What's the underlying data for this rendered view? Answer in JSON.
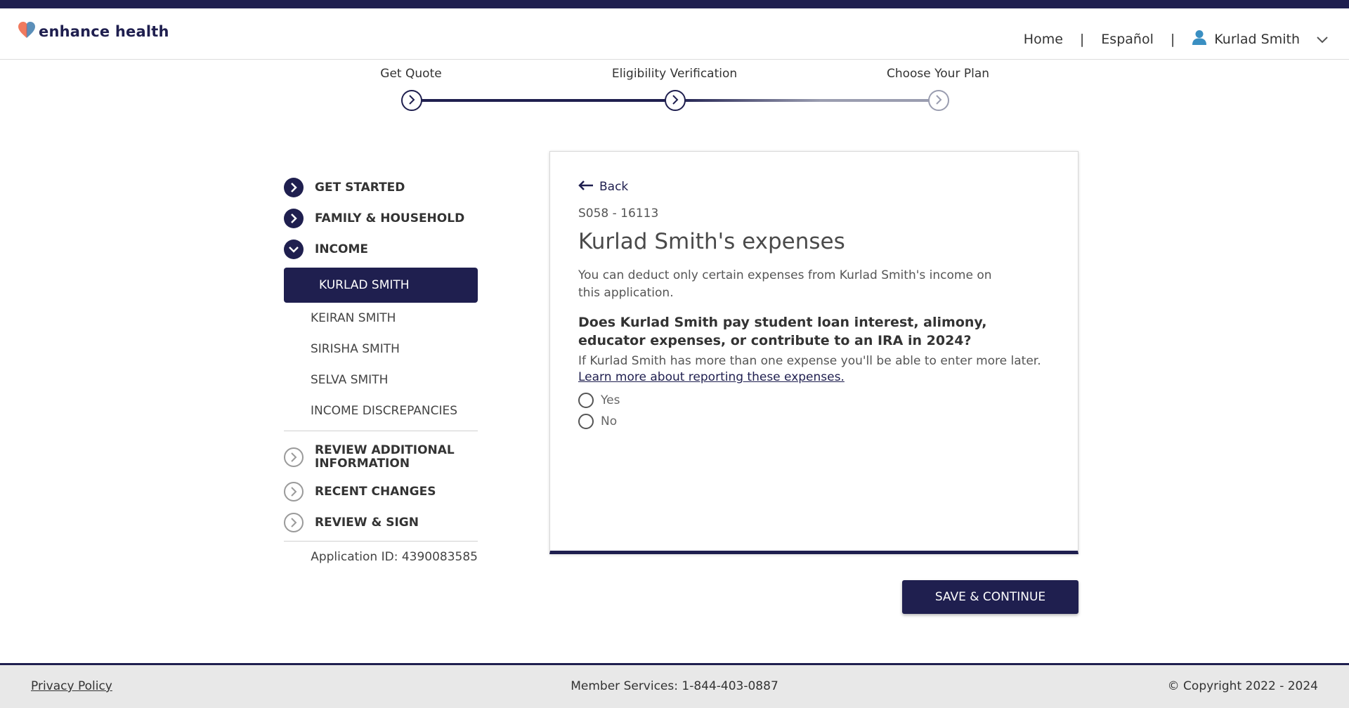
{
  "header": {
    "logo_text": "enhance health",
    "nav": {
      "home": "Home",
      "separator": "|",
      "language": "Español",
      "user_name": "Kurlad Smith"
    }
  },
  "progress": {
    "steps": [
      {
        "label": "Get Quote",
        "state": "complete"
      },
      {
        "label": "Eligibility Verification",
        "state": "current"
      },
      {
        "label": "Choose Your Plan",
        "state": "upcoming"
      }
    ]
  },
  "sidebar": {
    "sections_top": [
      {
        "label": "GET STARTED",
        "icon": "chevron-right-filled-icon"
      },
      {
        "label": "FAMILY & HOUSEHOLD",
        "icon": "chevron-right-filled-icon"
      },
      {
        "label": "INCOME",
        "icon": "chevron-down-filled-icon"
      }
    ],
    "active_item": "KURLAD SMITH",
    "sub_items": [
      "KEIRAN SMITH",
      "SIRISHA SMITH",
      "SELVA SMITH",
      "INCOME DISCREPANCIES"
    ],
    "sections_bottom": [
      {
        "label_line1": "REVIEW ADDITIONAL",
        "label_line2": "INFORMATION",
        "icon": "chevron-right-outline-icon"
      },
      {
        "label": "RECENT CHANGES",
        "icon": "chevron-right-outline-icon"
      },
      {
        "label": "REVIEW & SIGN",
        "icon": "chevron-right-outline-icon"
      }
    ],
    "application_id": "Application ID: 4390083585"
  },
  "card": {
    "back_label": "Back",
    "code": "S058 - 16113",
    "heading": "Kurlad Smith's expenses",
    "description": "You can deduct only certain expenses from Kurlad Smith's income on this application.",
    "question": "Does Kurlad Smith pay student loan interest, alimony, educator expenses, or contribute to an IRA in 2024?",
    "hint": "If Kurlad Smith has more than one expense you'll be able to enter more later.",
    "learn_more": "Learn more about reporting these expenses.",
    "options": [
      "Yes",
      "No"
    ]
  },
  "actions": {
    "save_continue": "SAVE & CONTINUE"
  },
  "footer": {
    "privacy": "Privacy Policy",
    "member_services": "Member Services: 1-844-403-0887",
    "copyright": "© Copyright 2022 - 2024"
  },
  "colors": {
    "brand_navy": "#1f1f4f",
    "logo_coral": "#f07a5e",
    "logo_blue": "#5b8fb9",
    "user_icon": "#3a8fc2"
  }
}
